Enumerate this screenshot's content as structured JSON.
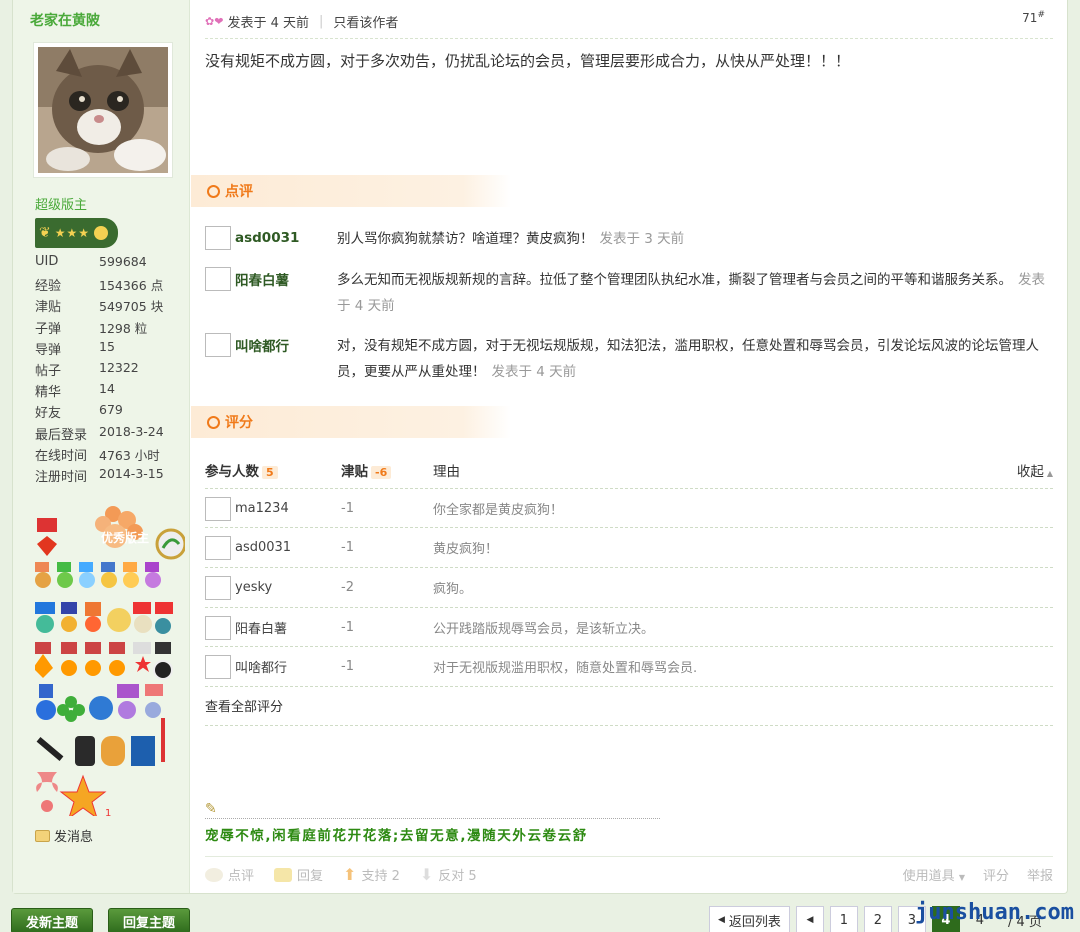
{
  "author": {
    "name": "老家在黄陂",
    "role": "超级版主",
    "stats": [
      {
        "k": "UID",
        "v": "599684"
      },
      {
        "k": "经验",
        "v": "154366 点"
      },
      {
        "k": "津贴",
        "v": "549705 块"
      },
      {
        "k": "子弹",
        "v": "1298 粒"
      },
      {
        "k": "导弹",
        "v": "15"
      },
      {
        "k": "帖子",
        "v": "12322"
      },
      {
        "k": "精华",
        "v": "14"
      },
      {
        "k": "好友",
        "v": "679"
      },
      {
        "k": "最后登录",
        "v": "2018-3-24"
      },
      {
        "k": "在线时间",
        "v": "4763 小时"
      },
      {
        "k": "注册时间",
        "v": "2014-3-15"
      }
    ],
    "medal_label": "优秀版主",
    "medal_count": "1",
    "message_label": "发消息"
  },
  "post": {
    "posted": "发表于 4 天前",
    "only_author": "只看该作者",
    "floor": "71",
    "floor_mark": "#",
    "content": "没有规矩不成方圆，对于多次劝告，仍扰乱论坛的会员，管理层要形成合力，从快从严处理！！！"
  },
  "comments": {
    "title": "点评",
    "items": [
      {
        "user": "asd0031",
        "text": "别人骂你疯狗就禁访？啥道理？黄皮疯狗！",
        "time": "发表于 3 天前"
      },
      {
        "user": "阳春白薯",
        "text": "多么无知而无视版规新规的言辞。拉低了整个管理团队执纪水准，撕裂了管理者与会员之间的平等和谐服务关系。",
        "time": "发表于 4 天前"
      },
      {
        "user": "叫啥都行",
        "text": "对，没有规矩不成方圆，对于无视坛规版规，知法犯法，滥用职权，任意处置和辱骂会员，引发论坛风波的论坛管理人员，更要从严从重处理！",
        "time": "发表于 4 天前"
      }
    ]
  },
  "rating": {
    "title": "评分",
    "col_people": "参与人数",
    "people_count": "5",
    "col_score": "津贴",
    "score_total": "-6",
    "col_reason": "理由",
    "collapse": "收起",
    "rows": [
      {
        "user": "ma1234",
        "score": "-1",
        "reason": "你全家都是黄皮疯狗！"
      },
      {
        "user": "asd0031",
        "score": "-1",
        "reason": "黄皮疯狗！"
      },
      {
        "user": "yesky",
        "score": "-2",
        "reason": "疯狗。"
      },
      {
        "user": "阳春白薯",
        "score": "-1",
        "reason": "公开践踏版规辱骂会员，是该斩立决。"
      },
      {
        "user": "叫啥都行",
        "score": "-1",
        "reason": "对于无视版规滥用职权，随意处置和辱骂会员."
      }
    ],
    "view_all": "查看全部评分"
  },
  "signature": "宠辱不惊,闲看庭前花开花落;去留无意,漫随天外云卷云舒",
  "actions": {
    "comment": "点评",
    "reply": "回复",
    "support": "支持 2",
    "oppose": "反对 5",
    "use_tool": "使用道具",
    "rate": "评分",
    "report": "举报"
  },
  "bottom": {
    "new_thread": "发新主题",
    "reply_thread": "回复主题",
    "back_list": "返回列表",
    "pages": [
      "1",
      "2",
      "3"
    ],
    "current_page": "4",
    "page_input": "4",
    "total_pages": "/ 4 页",
    "watermark": "junshuan.com"
  },
  "colors": {
    "accent_green": "#4aa93a",
    "section_orange": "#f07a1a",
    "signature_green": "#2d8a12"
  }
}
